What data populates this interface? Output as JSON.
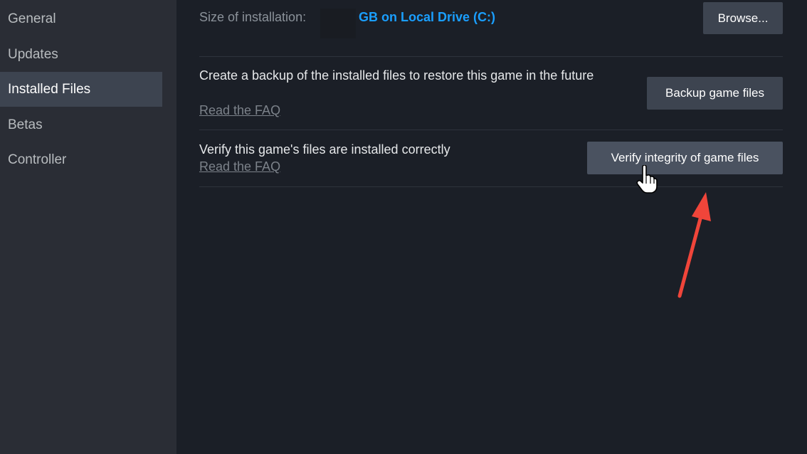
{
  "sidebar": {
    "items": [
      {
        "label": "General"
      },
      {
        "label": "Updates"
      },
      {
        "label": "Installed Files"
      },
      {
        "label": "Betas"
      },
      {
        "label": "Controller"
      }
    ],
    "active": "Installed Files"
  },
  "install": {
    "size_label": "Size of installation:",
    "size_value": "GB on Local Drive (C:)",
    "browse_label": "Browse..."
  },
  "backup": {
    "description": "Create a backup of the installed files to restore this game in the future",
    "faq_label": "Read the FAQ",
    "button_label": "Backup game files"
  },
  "verify": {
    "description": "Verify this game's files are installed correctly",
    "faq_label": "Read the FAQ",
    "button_label": "Verify integrity of game files"
  },
  "colors": {
    "accent": "#1a9fff",
    "annotation_arrow": "#f0453a",
    "background": "#1b1f27",
    "sidebar": "#2a2d35"
  },
  "annotation": {
    "icon": "red-arrow-icon"
  },
  "cursor": {
    "icon": "hand-pointer-icon"
  }
}
